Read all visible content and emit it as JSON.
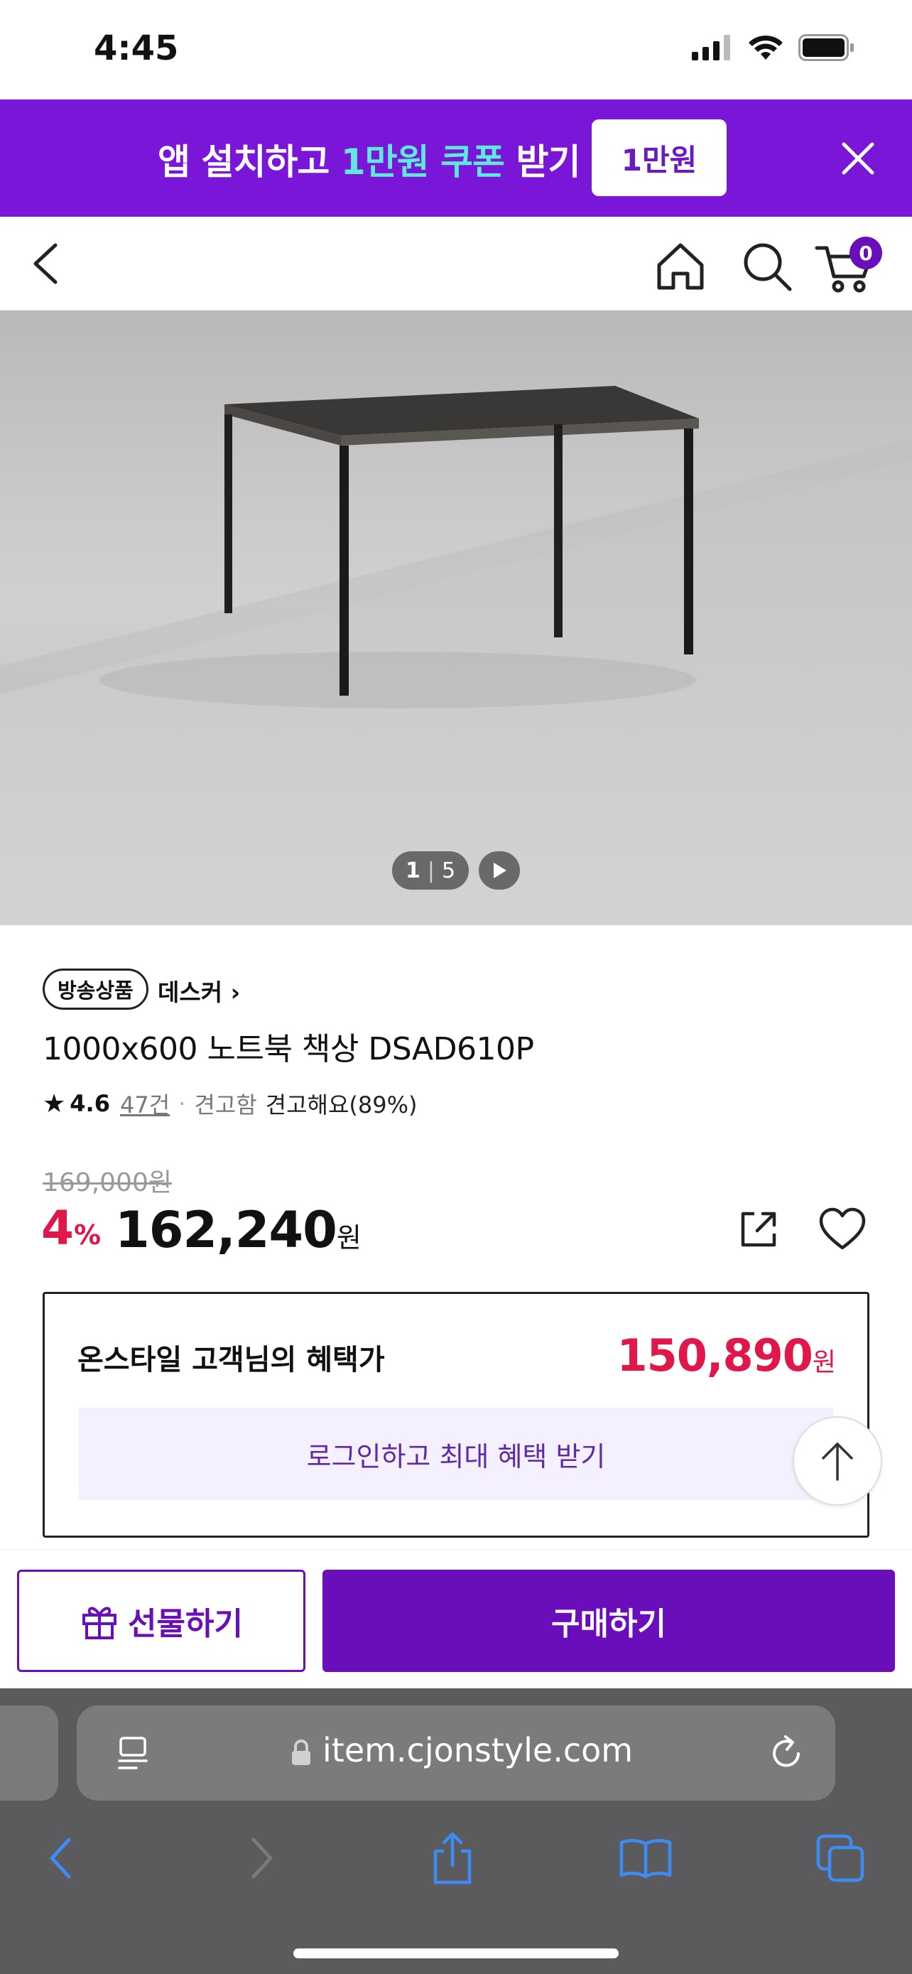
{
  "status_bar": {
    "time": "4:45"
  },
  "promo": {
    "text_before": "앱 설치하고 ",
    "text_highlight": "1만원 쿠폰",
    "text_after": " 받기",
    "badge": "1만원"
  },
  "cart": {
    "count": "0"
  },
  "gallery": {
    "current": "1",
    "separator": "|",
    "total": "5"
  },
  "product": {
    "badge": "방송상품",
    "brand": "데스커 ›",
    "title": "1000x600 노트북 책상 DSAD610P",
    "rating": {
      "star": "★",
      "score": "4.6",
      "reviews": "47건",
      "dot": "·",
      "durability_label": "견고함",
      "durability_value": "견고해요(89%)"
    },
    "original_price": "169,000원",
    "discount_rate": "4",
    "discount_unit": "%",
    "price": "162,240",
    "price_unit": "원"
  },
  "benefit": {
    "label": "온스타일 고객님의 혜택가",
    "price": "150,890",
    "price_unit": "원",
    "login_text": "로그인하고 최대 혜택 받기"
  },
  "actions": {
    "gift": "선물하기",
    "buy": "구매하기"
  },
  "browser": {
    "url": "item.cjonstyle.com"
  },
  "colors": {
    "brand_purple": "#6a0dbb",
    "promo_purple": "#7a16d8",
    "sale_red": "#e0174a",
    "highlight_mint": "#5fe8dd"
  }
}
